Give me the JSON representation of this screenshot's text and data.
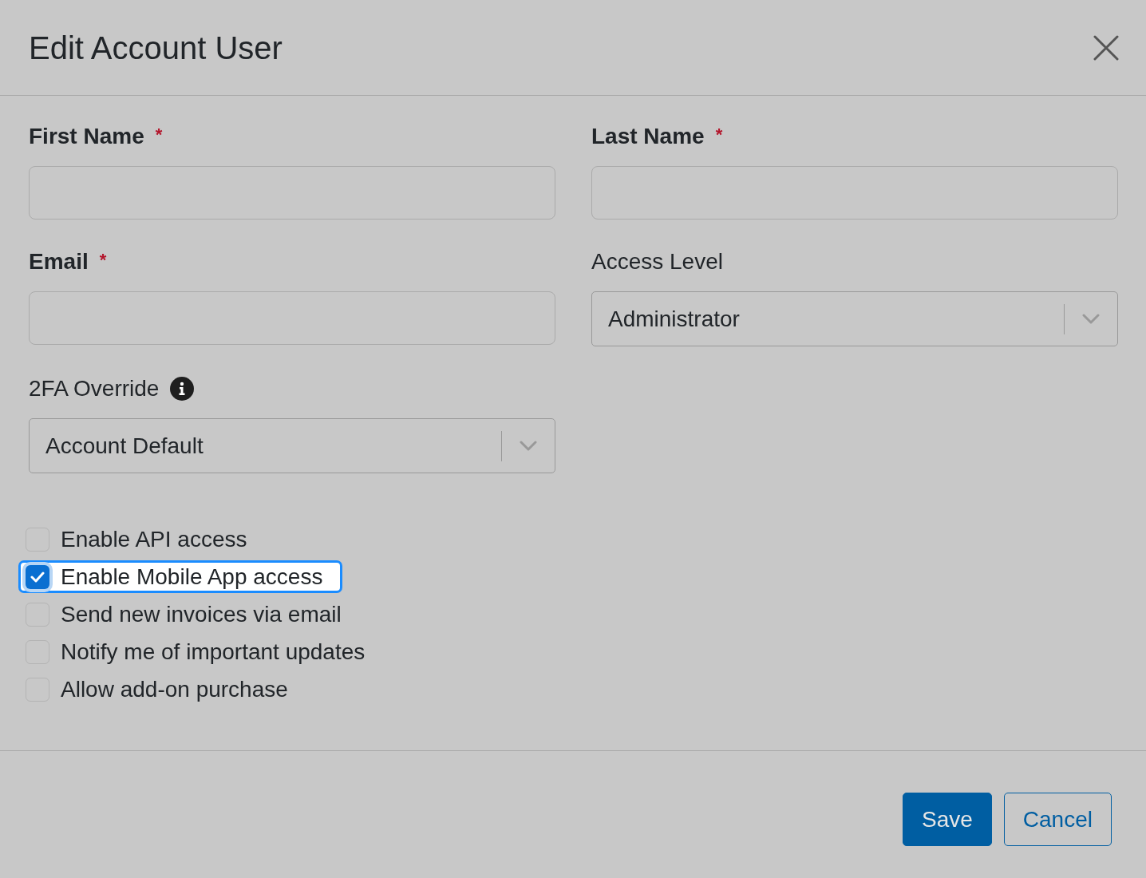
{
  "dialog": {
    "title": "Edit Account User"
  },
  "fields": [
    {
      "kind": "text",
      "label": "First Name",
      "required_mark": "*"
    },
    {
      "kind": "text",
      "label": "Last Name",
      "required_mark": "*"
    },
    {
      "kind": "text",
      "label": "Email",
      "required_mark": "*"
    },
    {
      "kind": "select",
      "label": "Access Level",
      "value": "Administrator"
    },
    {
      "kind": "select",
      "label": "2FA Override",
      "info": true,
      "value": "Account Default"
    }
  ],
  "options": [
    {
      "label": "Enable API access",
      "checked": false,
      "focused": false
    },
    {
      "label": "Enable Mobile App access",
      "checked": true,
      "focused": true
    },
    {
      "label": "Send new invoices via email",
      "checked": false,
      "focused": false
    },
    {
      "label": "Notify me of important updates",
      "checked": false,
      "focused": false
    },
    {
      "label": "Allow add-on purchase",
      "checked": false,
      "focused": false
    }
  ],
  "buttons": [
    {
      "kind": "primary",
      "label": "Save"
    },
    {
      "kind": "secondary",
      "label": "Cancel"
    }
  ]
}
